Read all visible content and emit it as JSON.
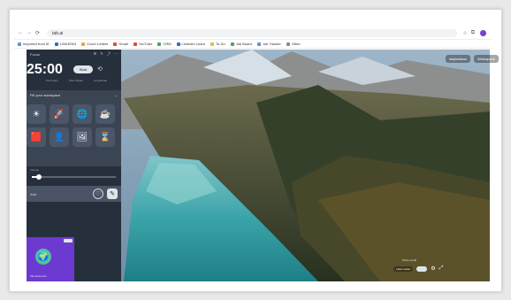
{
  "browser": {
    "url": "tab.ai",
    "bookmarks": [
      {
        "label": "Imported from IE",
        "color": "#6b8bd6"
      },
      {
        "label": "LINKEDIN",
        "color": "#2d6ad9"
      },
      {
        "label": "Cover Letters",
        "color": "#e7a43a"
      },
      {
        "label": "Gmail",
        "color": "#d94b3e"
      },
      {
        "label": "YouTube",
        "color": "#d94b3e"
      },
      {
        "label": "CRM",
        "color": "#56a05a"
      },
      {
        "label": "LinkedIn Learn",
        "color": "#2d6ad9"
      },
      {
        "label": "To-Do",
        "color": "#d9c23e"
      },
      {
        "label": "Job Board",
        "color": "#56a05a"
      },
      {
        "label": "Job Tracker",
        "color": "#6b8bd6"
      },
      {
        "label": "Other",
        "color": "#8a8a8a"
      }
    ]
  },
  "panel": {
    "top_label": "Focus",
    "time": "25:00",
    "start_label": "Start",
    "sub_left": "Pomodoro",
    "sub_mid": "Short Break",
    "sub_right": "Long Break",
    "workspace_header": "Fill your workspace",
    "workspace_bottom_label": "Add",
    "slider_label": "Volume",
    "slider_value": 0.08,
    "card_caption": "Tab Extension"
  },
  "tiles": [
    {
      "icon": "☀"
    },
    {
      "icon": "🚀"
    },
    {
      "icon": "🌐"
    },
    {
      "icon": "☕"
    },
    {
      "icon": "🟥"
    },
    {
      "icon": "👤"
    },
    {
      "icon": "🖼"
    },
    {
      "icon": "⌛"
    }
  ],
  "overlay": {
    "top_right_1": "Inspirations",
    "top_right_2": "Workspace",
    "bottom_label": "Lake Louise",
    "credit": "Photo credit"
  }
}
